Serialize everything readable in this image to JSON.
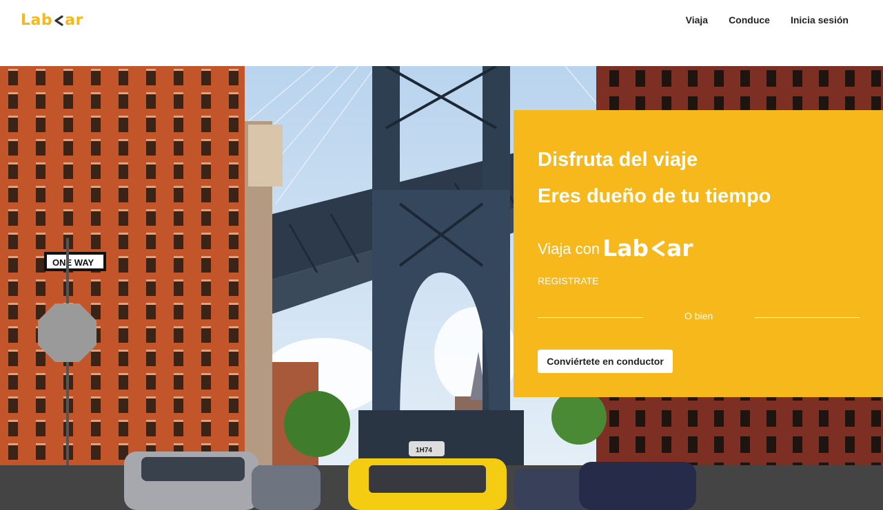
{
  "brand": {
    "logo_prefix": "Lab",
    "logo_suffix": "ar",
    "logo_color": "#f6b81a"
  },
  "nav": {
    "items": [
      {
        "label": "Viaja"
      },
      {
        "label": "Conduce"
      },
      {
        "label": "Inicia sesión"
      }
    ]
  },
  "hero": {
    "image": "city-street-bridge-with-taxi",
    "headline_1": "Disfruta del viaje",
    "headline_2": "Eres dueño de tu tiempo",
    "viaja_con": "Viaja con",
    "registrate": "REGISTRATE",
    "or_text": "O bien",
    "driver_button": "Conviértete en conductor",
    "panel_color": "#f6b81a"
  }
}
